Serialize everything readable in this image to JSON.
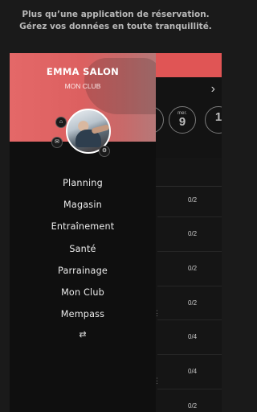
{
  "banner": {
    "line1": "Plus qu’une application de réservation.",
    "line2": "Gérez vos données en toute tranquillité."
  },
  "drawer": {
    "user_name": "EMMA SALON",
    "club_name": "MON CLUB",
    "menu": [
      {
        "label": "Planning"
      },
      {
        "label": "Magasin"
      },
      {
        "label": "Entraînement"
      },
      {
        "label": "Santé"
      },
      {
        "label": "Parrainage"
      },
      {
        "label": "Mon Club"
      },
      {
        "label": "Mempass"
      }
    ],
    "icons": {
      "home": "home-icon",
      "mail": "mail-icon",
      "settings": "gear-icon",
      "shuffle": "shuffle-icon"
    }
  },
  "background": {
    "days": [
      {
        "name": "",
        "num": ""
      },
      {
        "name": "mer.",
        "num": "9"
      },
      {
        "name": "",
        "num": "1"
      }
    ],
    "counts": [
      "0/2",
      "0/2",
      "0/2",
      "0/2",
      "0/4",
      "0/4",
      "0/2"
    ]
  },
  "colors": {
    "accent": "#e05555",
    "background": "#1a1a1a",
    "drawer": "#0f0f0f"
  }
}
